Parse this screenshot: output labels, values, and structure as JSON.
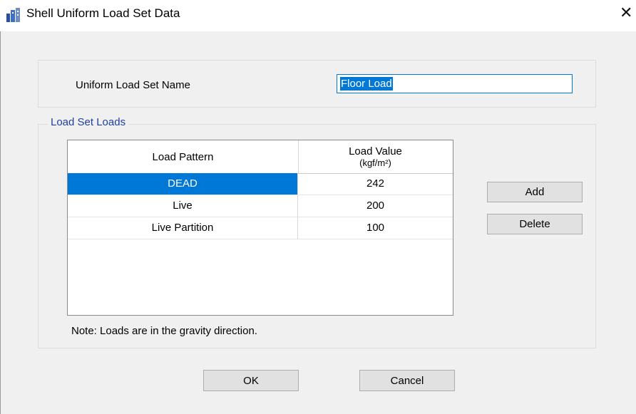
{
  "window": {
    "title": "Shell Uniform Load Set Data"
  },
  "name_group": {
    "label": "Uniform Load Set Name",
    "value": "Floor Load"
  },
  "loads_group": {
    "legend": "Load Set Loads",
    "columns": {
      "pattern": "Load Pattern",
      "value": "Load Value",
      "unit": "(kgf/m²)"
    },
    "rows": [
      {
        "pattern": "DEAD",
        "value": "242",
        "selected": true
      },
      {
        "pattern": "Live",
        "value": "200",
        "selected": false
      },
      {
        "pattern": "Live Partition",
        "value": "100",
        "selected": false
      }
    ],
    "note": "Note:  Loads are in the gravity direction."
  },
  "buttons": {
    "add": "Add",
    "delete": "Delete",
    "ok": "OK",
    "cancel": "Cancel"
  },
  "colors": {
    "selection": "#0078d7",
    "legend": "#1f3fa0"
  }
}
